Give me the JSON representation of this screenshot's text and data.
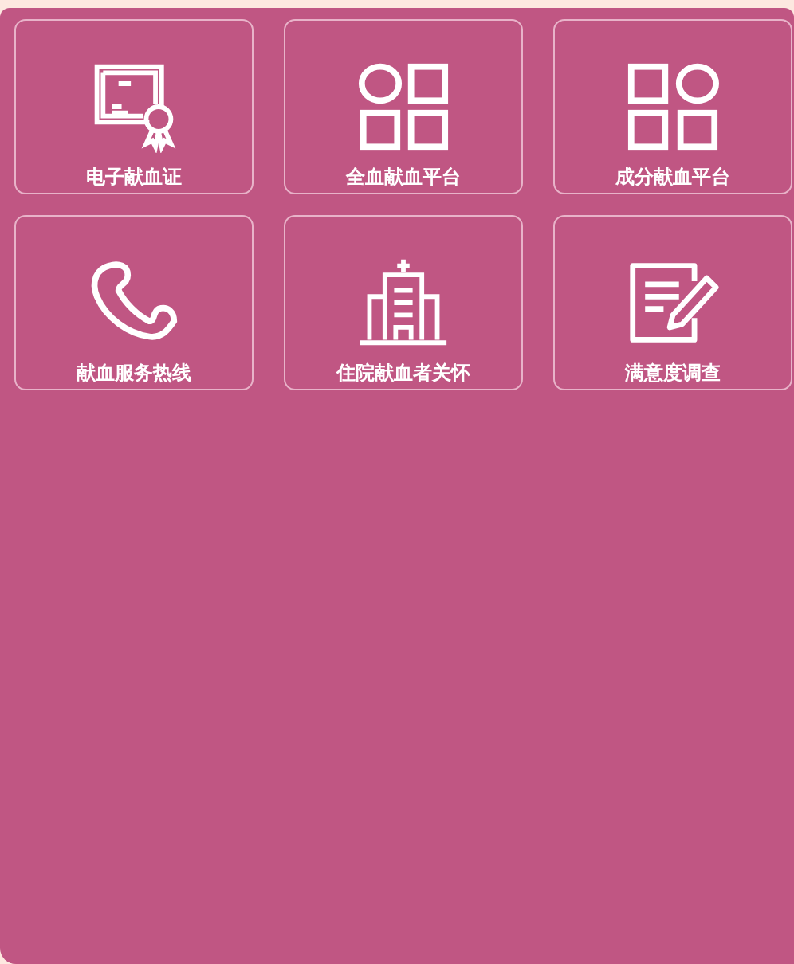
{
  "tiles": [
    {
      "label": "电子献血证",
      "kind": "certificate"
    },
    {
      "label": "全血献血平台",
      "kind": "grid-circle-left"
    },
    {
      "label": "成分献血平台",
      "kind": "grid-circle-right"
    },
    {
      "label": "献血服务热线",
      "kind": "phone"
    },
    {
      "label": "住院献血者关怀",
      "kind": "hospital"
    },
    {
      "label": "满意度调查",
      "kind": "survey"
    }
  ]
}
